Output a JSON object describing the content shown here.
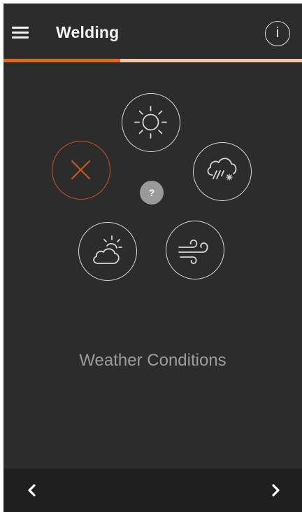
{
  "header": {
    "title": "Welding",
    "menu_icon": "hamburger-menu-icon",
    "info_label": "i",
    "info_icon": "info-circle-icon"
  },
  "progress": {
    "fraction": 0.39,
    "fill_color": "#e2661f",
    "track_color": "#f2c6a6"
  },
  "options": [
    {
      "id": "none",
      "icon": "close-x-icon",
      "selected": true
    },
    {
      "id": "sunny",
      "icon": "sun-icon",
      "selected": false
    },
    {
      "id": "rain-snow",
      "icon": "cloud-rain-snow-icon",
      "selected": false
    },
    {
      "id": "partly-cloudy",
      "icon": "sun-behind-cloud-icon",
      "selected": false
    },
    {
      "id": "windy",
      "icon": "wind-icon",
      "selected": false
    }
  ],
  "help": {
    "label": "?",
    "icon": "question-mark-icon"
  },
  "question": {
    "label": "Weather Conditions"
  },
  "navigation": {
    "prev_icon": "chevron-left-icon",
    "next_icon": "chevron-right-icon"
  },
  "colors": {
    "background": "#2c2c2c",
    "accent": "#e2661f",
    "selected_stroke": "#c8561c",
    "icon_stroke": "#d6d6d6",
    "bottom_bar": "#1f1f1f",
    "label": "#9c9c9c"
  }
}
